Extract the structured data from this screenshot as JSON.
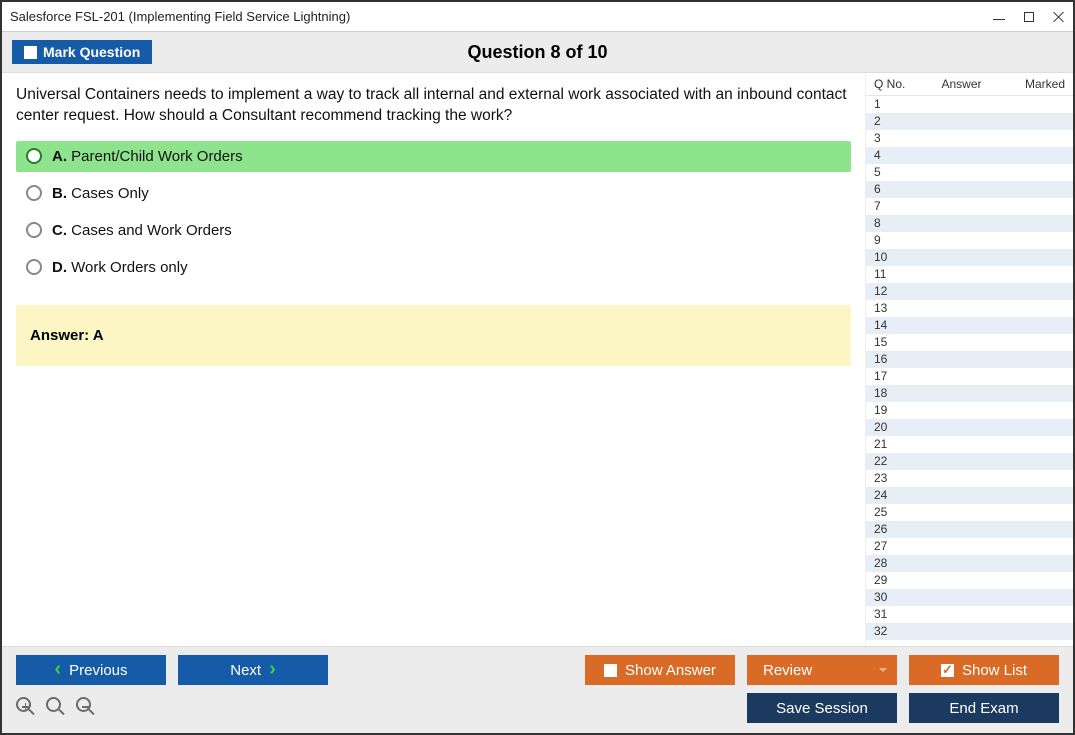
{
  "window": {
    "title": "Salesforce FSL-201 (Implementing Field Service Lightning)"
  },
  "header": {
    "mark_label": "Mark Question",
    "question_title": "Question 8 of 10"
  },
  "question": {
    "text": "Universal Containers needs to implement a way to track all internal and external work associated with an inbound contact center request. How should a Consultant recommend tracking the work?",
    "options": [
      {
        "letter": "A.",
        "text": "Parent/Child Work Orders",
        "selected": true
      },
      {
        "letter": "B.",
        "text": "Cases Only",
        "selected": false
      },
      {
        "letter": "C.",
        "text": "Cases and Work Orders",
        "selected": false
      },
      {
        "letter": "D.",
        "text": "Work Orders only",
        "selected": false
      }
    ],
    "answer_label": "Answer: A"
  },
  "sidebar": {
    "col_qno": "Q No.",
    "col_answer": "Answer",
    "col_marked": "Marked",
    "rows": [
      "1",
      "2",
      "3",
      "4",
      "5",
      "6",
      "7",
      "8",
      "9",
      "10",
      "11",
      "12",
      "13",
      "14",
      "15",
      "16",
      "17",
      "18",
      "19",
      "20",
      "21",
      "22",
      "23",
      "24",
      "25",
      "26",
      "27",
      "28",
      "29",
      "30",
      "31",
      "32"
    ]
  },
  "toolbar": {
    "previous": "Previous",
    "next": "Next",
    "show_answer": "Show Answer",
    "review": "Review",
    "show_list": "Show List",
    "save_session": "Save Session",
    "end_exam": "End Exam"
  }
}
